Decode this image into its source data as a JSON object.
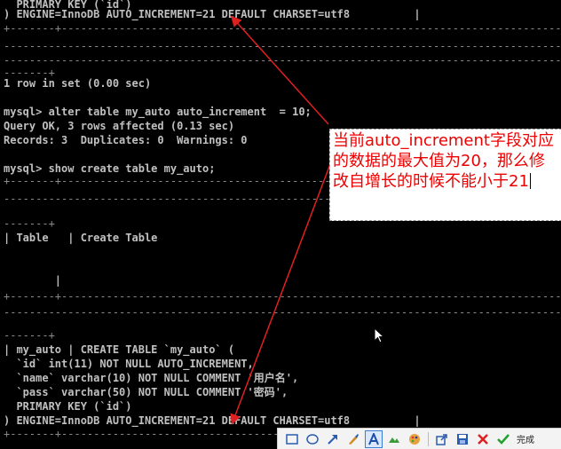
{
  "terminal": {
    "lines": [
      {
        "text": "  PRIMARY KEY (`id`)",
        "kind": "text"
      },
      {
        "text": ") ENGINE=InnoDB AUTO_INCREMENT=21 DEFAULT CHARSET=utf8          |",
        "kind": "text"
      },
      {
        "text": "+-------+------------------------------------------------------------------------------------------",
        "kind": "dash"
      },
      {
        "text": "--------------------------------------------------------------------------------------------------",
        "kind": "dash"
      },
      {
        "text": "",
        "kind": "text"
      },
      {
        "text": "--------------------------------------------------------------------------------------------------",
        "kind": "dash"
      },
      {
        "text": "-------+",
        "kind": "dash"
      },
      {
        "text": "1 row in set (0.00 sec)",
        "kind": "text"
      },
      {
        "text": "",
        "kind": "text"
      },
      {
        "text": "mysql> alter table my_auto auto_increment  = 10;",
        "kind": "text"
      },
      {
        "text": "Query OK, 3 rows affected (0.13 sec)",
        "kind": "text"
      },
      {
        "text": "Records: 3  Duplicates: 0  Warnings: 0",
        "kind": "text"
      },
      {
        "text": "",
        "kind": "text"
      },
      {
        "text": "mysql> show create table my_auto;",
        "kind": "text"
      },
      {
        "text": "+-------+------------------------------------------------------------------------------------------",
        "kind": "dash"
      },
      {
        "text": "--------------------------------------------------------------------------------------------------",
        "kind": "dash"
      },
      {
        "text": "",
        "kind": "text"
      },
      {
        "text": "-------+",
        "kind": "dash"
      },
      {
        "text": "| Table   | Create Table",
        "kind": "text"
      },
      {
        "text": "",
        "kind": "text"
      },
      {
        "text": "",
        "kind": "text"
      },
      {
        "text": "",
        "kind": "text"
      },
      {
        "text": "        |",
        "kind": "text"
      },
      {
        "text": "+-------+------------------------------------------------------------------------------------------",
        "kind": "dash"
      },
      {
        "text": "--------------------------------------------------------------------------------------------------",
        "kind": "dash"
      },
      {
        "text": "",
        "kind": "text"
      },
      {
        "text": "-------+",
        "kind": "dash"
      },
      {
        "text": "| my_auto | CREATE TABLE `my_auto` (",
        "kind": "text"
      },
      {
        "text": "  `id` int(11) NOT NULL AUTO_INCREMENT,",
        "kind": "text"
      },
      {
        "text": "  `name` varchar(10) NOT NULL COMMENT '用户名',",
        "kind": "text"
      },
      {
        "text": "  `pass` varchar(50) NOT NULL COMMENT '密码',",
        "kind": "text"
      },
      {
        "text": "  PRIMARY KEY (`id`)",
        "kind": "text"
      },
      {
        "text": ") ENGINE=InnoDB AUTO_INCREMENT=21 DEFAULT CHARSET=utf8          |",
        "kind": "text"
      },
      {
        "text": "+-------+------------------------------------------------------------------------------------------",
        "kind": "dash"
      }
    ]
  },
  "annotation": {
    "text": "当前auto_increment字段对应的数据的最大值为20，那么修改自增长的时候不能小于21",
    "color": "#ee0000"
  },
  "toolbar": {
    "tools": [
      "rectangle-icon",
      "ellipse-icon",
      "arrow-icon",
      "brush-icon",
      "text-icon",
      "highlight-icon",
      "palette-icon",
      "share-icon",
      "save-icon",
      "close-icon",
      "confirm-icon"
    ],
    "done_label": "完成"
  }
}
